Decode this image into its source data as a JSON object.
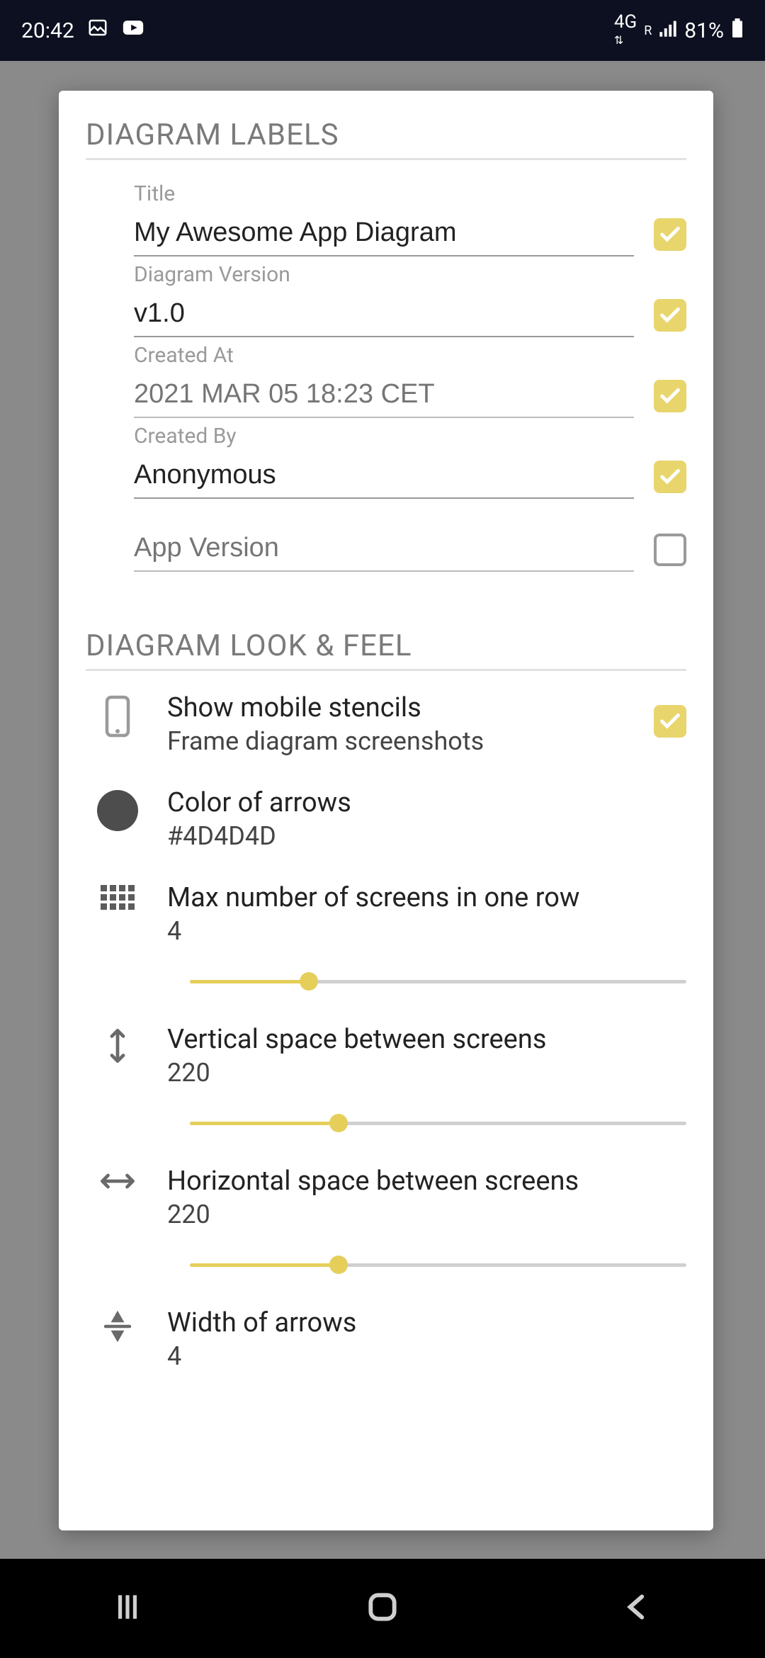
{
  "status": {
    "time": "20:42",
    "net": "4G",
    "roam": "R",
    "battery": "81%"
  },
  "section1": "DIAGRAM LABELS",
  "section2": "DIAGRAM LOOK & FEEL",
  "fields": {
    "title": {
      "label": "Title",
      "value": "My Awesome App Diagram",
      "checked": true
    },
    "version": {
      "label": "Diagram Version",
      "value": "v1.0",
      "checked": true
    },
    "createdAt": {
      "label": "Created At",
      "value": "",
      "placeholder": "2021 MAR 05 18:23 CET",
      "checked": true
    },
    "createdBy": {
      "label": "Created By",
      "value": "Anonymous",
      "checked": true
    },
    "appVersion": {
      "label": "",
      "value": "",
      "placeholder": "App Version",
      "checked": false
    }
  },
  "look": {
    "stencils": {
      "title": "Show mobile stencils",
      "sub": "Frame diagram screenshots",
      "checked": true
    },
    "arrowColor": {
      "title": "Color of arrows",
      "value": "#4D4D4D"
    },
    "maxScreens": {
      "title": "Max number of screens in one row",
      "value": "4",
      "percent": 24
    },
    "vSpace": {
      "title": "Vertical space between screens",
      "value": "220",
      "percent": 30
    },
    "hSpace": {
      "title": "Horizontal space between screens",
      "value": "220",
      "percent": 30
    },
    "arrowWidth": {
      "title": "Width of arrows",
      "value": "4"
    }
  }
}
